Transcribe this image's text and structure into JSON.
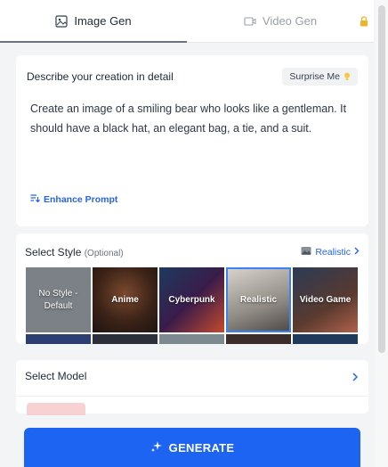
{
  "tabs": [
    {
      "label": "Image Gen",
      "icon": "image-icon",
      "active": true
    },
    {
      "label": "Video Gen",
      "icon": "video-icon",
      "active": false,
      "locked": true
    }
  ],
  "describe": {
    "title": "Describe your creation in detail",
    "surprise_label": "Surprise Me",
    "prompt": "Create an image of a smiling bear who looks like a gentleman. It should have a black hat, an elegant bag, a tie, and a suit.",
    "enhance_label": "Enhance Prompt"
  },
  "style": {
    "title": "Select Style",
    "optional": "(Optional)",
    "selected_label": "Realistic",
    "options": [
      {
        "label": "No Style -\nDefault"
      },
      {
        "label": "Anime"
      },
      {
        "label": "Cyberpunk"
      },
      {
        "label": "Realistic",
        "selected": true
      },
      {
        "label": "Video Game"
      }
    ]
  },
  "model": {
    "title": "Select Model"
  },
  "generate_label": "GENERATE",
  "colors": {
    "accent": "#1d64f2",
    "link": "#2563eb",
    "lock": "#f0b429",
    "bulb": "#f6c94b"
  }
}
